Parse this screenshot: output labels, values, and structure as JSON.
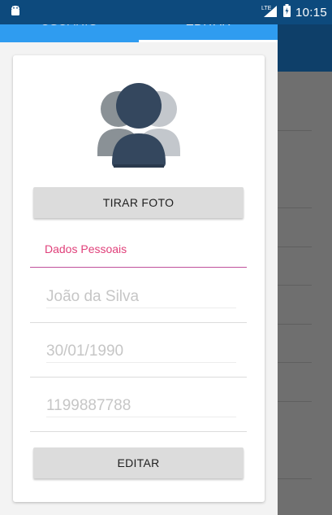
{
  "status_bar": {
    "time": "10:15",
    "network_label": "LTE",
    "icons": [
      "android-icon",
      "lte-signal-icon",
      "battery-icon"
    ]
  },
  "tabs": [
    {
      "label": "USUÁRIO",
      "selected": false
    },
    {
      "label": "EDITAR",
      "selected": true
    }
  ],
  "profile": {
    "avatar_icon": "users-group-icon",
    "take_photo_label": "TIRAR FOTO",
    "section_title": "Dados Pessoais",
    "fields": {
      "name": "João da Silva",
      "birthdate": "30/01/1990",
      "phone": "1199887788"
    },
    "edit_label": "EDITAR"
  },
  "colors": {
    "tab_bar": "#2f9cf0",
    "accent": "#e0407a",
    "status_bar": "#0d4a7d",
    "button": "#dcdcdc"
  }
}
